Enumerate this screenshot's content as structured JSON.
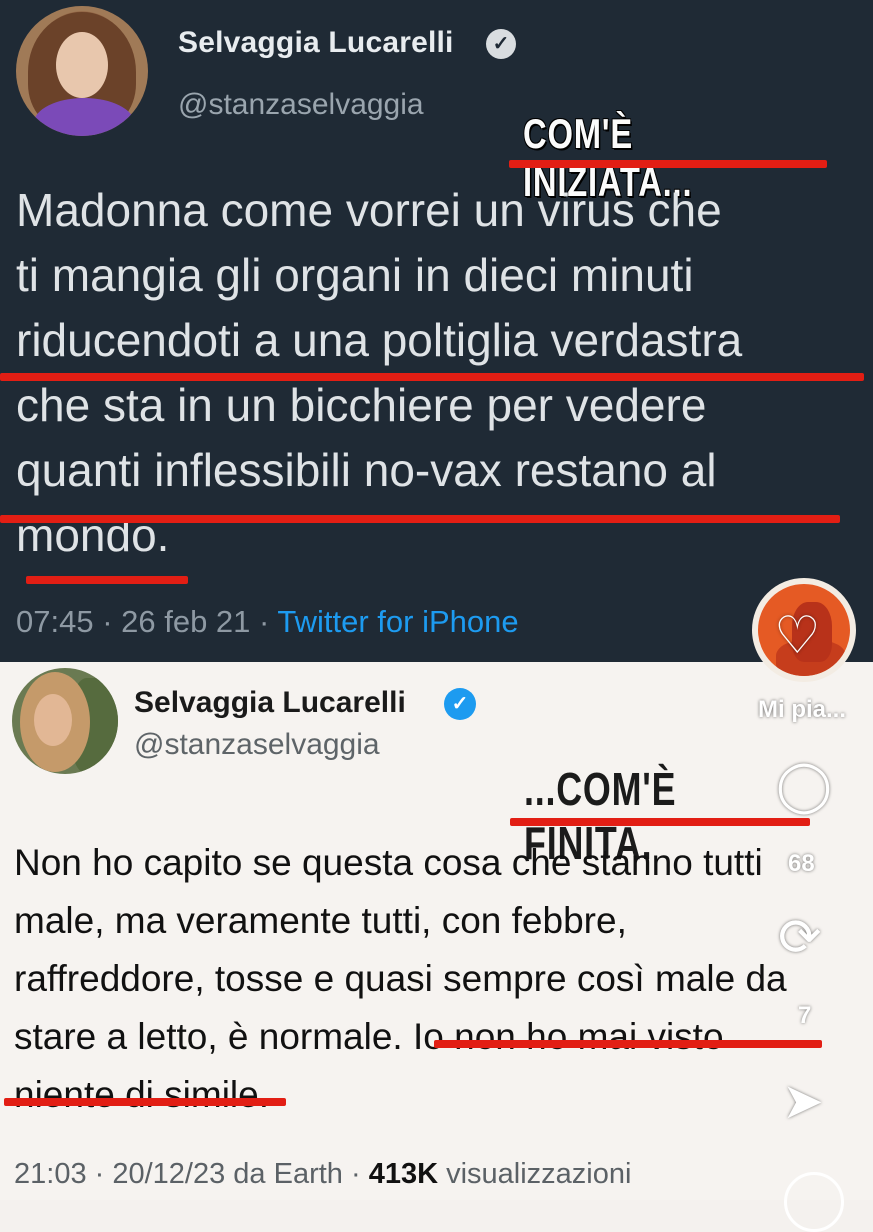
{
  "top_tweet": {
    "name": "Selvaggia Lucarelli",
    "handle": "@stanzaselvaggia",
    "annotation": "COM'È INIZIATA...",
    "lines": [
      "Madonna come vorrei un virus che",
      "ti mangia gli organi in dieci minuti",
      "riducendoti a una poltiglia verdastra",
      "che sta in un bicchiere per vedere",
      "quanti inflessibili no-vax restano al",
      "mondo."
    ],
    "time": "07:45 · 26 feb 21 · ",
    "source": "Twitter for iPhone"
  },
  "bottom_tweet": {
    "name": "Selvaggia Lucarelli",
    "handle": "@stanzaselvaggia",
    "annotation": "...COM'È FINITA.",
    "lines": [
      "Non ho capito se questa cosa che stanno tutti",
      "male, ma veramente tutti, con febbre,",
      "raffreddore, tosse e quasi sempre così male da",
      "stare a letto,  è normale. Io non ho mai visto",
      "niente di simile."
    ],
    "meta_prefix": "21:03 · 20/12/23 da Earth · ",
    "views": "413K",
    "views_suffix": " visualizzazioni"
  },
  "overlay": {
    "like_label": "Mi pia...",
    "comment_count": "68",
    "repost_count": "7",
    "icons": [
      "heart-icon",
      "comment-icon",
      "repost-icon",
      "share-icon"
    ]
  },
  "colors": {
    "dark_bg": "#1f2a35",
    "underline_red": "#e21e14",
    "twitter_blue": "#1d9bf0"
  }
}
